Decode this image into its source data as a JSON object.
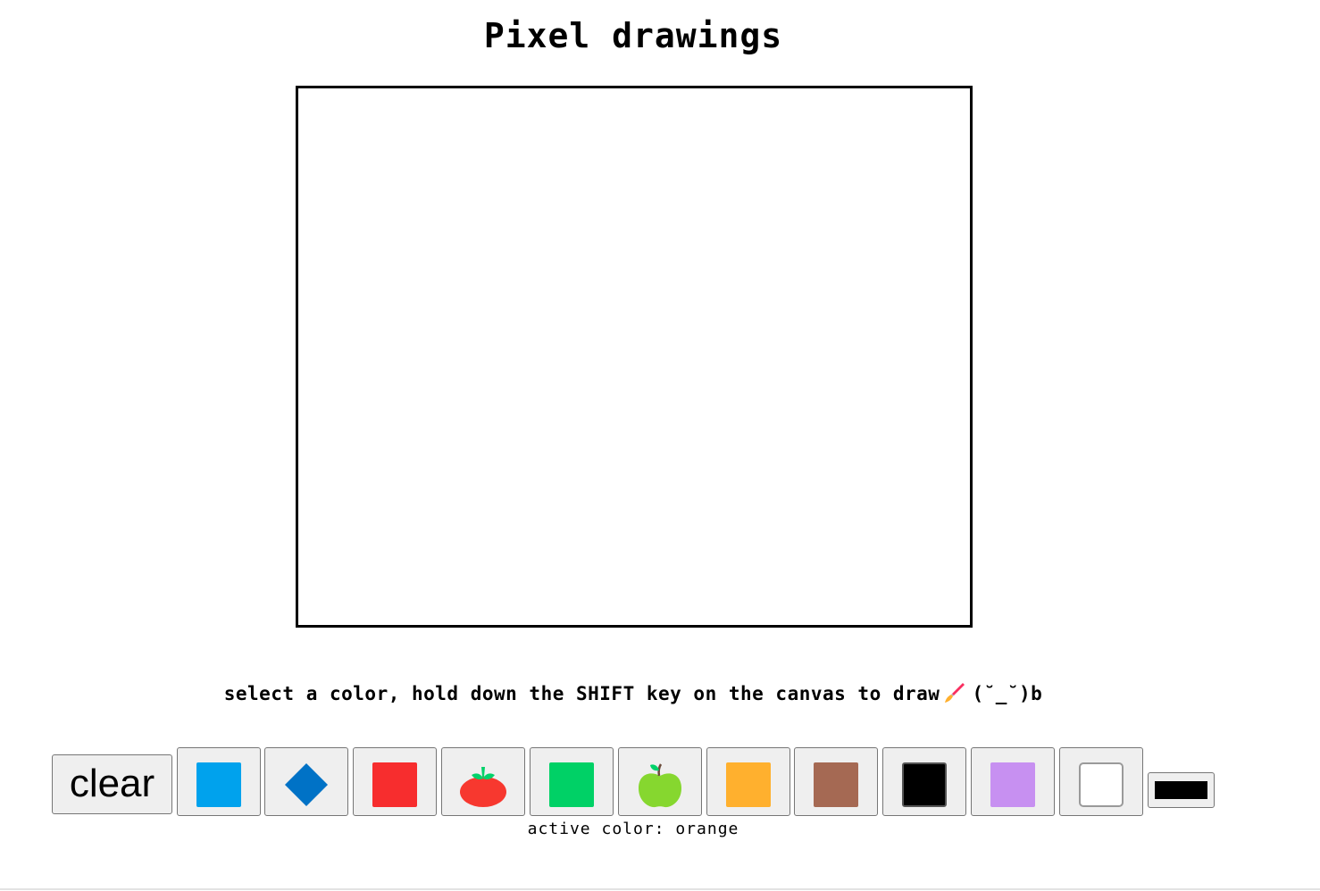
{
  "page": {
    "title": "Pixel drawings",
    "instructions": "select a color, hold down the SHIFT key on the canvas to draw",
    "instructions_icon": "paintbrush-icon",
    "instructions_suffix": "(˘_˘)b",
    "active_color_text": "active color: orange"
  },
  "toolbar": {
    "clear_label": "clear",
    "swatches": [
      {
        "name": "blue",
        "kind": "square",
        "color": "#00a2ed"
      },
      {
        "name": "diamond",
        "kind": "diamond-icon",
        "color": "#0072c6"
      },
      {
        "name": "red",
        "kind": "square",
        "color": "#f72d2e"
      },
      {
        "name": "tomato",
        "kind": "tomato-icon",
        "color": "#f7382f"
      },
      {
        "name": "green",
        "kind": "square",
        "color": "#00d166"
      },
      {
        "name": "green-apple",
        "kind": "apple-icon",
        "color": "#86d72f"
      },
      {
        "name": "orange",
        "kind": "square",
        "color": "#ffb02e"
      },
      {
        "name": "brown",
        "kind": "square",
        "color": "#a56953"
      },
      {
        "name": "black",
        "kind": "square",
        "color": "#000000"
      },
      {
        "name": "purple",
        "kind": "square",
        "color": "#c790f1"
      },
      {
        "name": "white",
        "kind": "square",
        "color": "#ffffff"
      }
    ],
    "picker_value": "#000000"
  }
}
